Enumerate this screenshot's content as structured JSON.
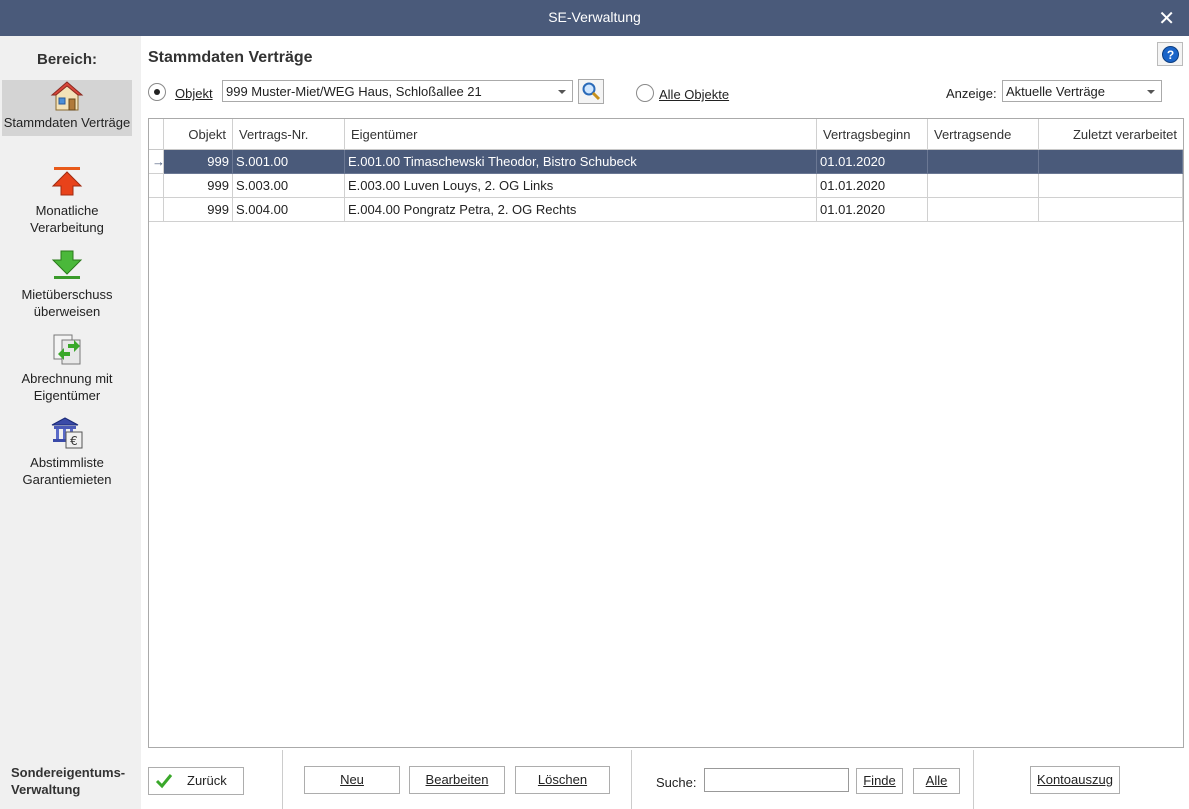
{
  "window": {
    "title": "SE-Verwaltung",
    "close": "✕"
  },
  "sidebar": {
    "heading": "Bereich:",
    "items": [
      {
        "label": "Stammdaten Verträge",
        "icon": "house-icon",
        "active": true
      },
      {
        "label": "Monatliche Verarbeitung",
        "icon": "arrow-up-icon"
      },
      {
        "label": "Mietüberschuss überweisen",
        "icon": "arrow-down-icon"
      },
      {
        "label": "Abrechnung mit Eigentümer",
        "icon": "document-exchange-icon"
      },
      {
        "label": "Abstimmliste Garantiemieten",
        "icon": "bank-euro-icon"
      }
    ],
    "footer_line1": "Sondereigentums-",
    "footer_line2": "Verwaltung"
  },
  "header": {
    "title": "Stammdaten Verträge",
    "help": "?",
    "objekt_label": "Objekt",
    "objekt_value": "999 Muster-Miet/WEG Haus, Schloßallee 21",
    "alle_objekte_label": "Alle Objekte",
    "anzeige_label": "Anzeige:",
    "anzeige_value": "Aktuelle Verträge"
  },
  "table": {
    "columns": [
      "Objekt",
      "Vertrags-Nr.",
      "Eigentümer",
      "Vertragsbeginn",
      "Vertragsende",
      "Zuletzt verarbeitet"
    ],
    "rows": [
      {
        "objekt": "999",
        "vertrag": "S.001.00",
        "eigentuemer": "E.001.00 Timaschewski Theodor, Bistro Schubeck",
        "beginn": "01.01.2020",
        "ende": "",
        "zuletzt": "",
        "indicator": "→"
      },
      {
        "objekt": "999",
        "vertrag": "S.003.00",
        "eigentuemer": "E.003.00 Luven Louys, 2. OG Links",
        "beginn": "01.01.2020",
        "ende": "",
        "zuletzt": "",
        "indicator": ""
      },
      {
        "objekt": "999",
        "vertrag": "S.004.00",
        "eigentuemer": "E.004.00 Pongratz Petra, 2. OG Rechts",
        "beginn": "01.01.2020",
        "ende": "",
        "zuletzt": "",
        "indicator": ""
      }
    ]
  },
  "footer": {
    "zurueck": "Zurück",
    "neu": "Neu",
    "bearbeiten": "Bearbeiten",
    "loeschen": "Löschen",
    "suche_label": "Suche:",
    "suche_value": "",
    "finde": "Finde",
    "alle": "Alle",
    "kontoauszug": "Kontoauszug"
  },
  "colors": {
    "titlebar": "#4a5a7a",
    "selection": "#4a5a7a",
    "sidebar": "#f0f0f0"
  }
}
